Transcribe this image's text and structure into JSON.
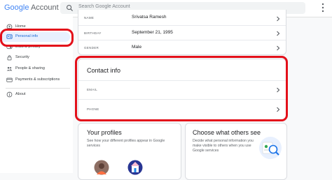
{
  "header": {
    "logo_google": "Google",
    "logo_account": "Account",
    "search_placeholder": "Search Google Account"
  },
  "sidebar": {
    "items": [
      {
        "label": "Home"
      },
      {
        "label": "Personal info"
      },
      {
        "label": "Data & privacy"
      },
      {
        "label": "Security"
      },
      {
        "label": "People & sharing"
      },
      {
        "label": "Payments & subscriptions"
      },
      {
        "label": "About"
      }
    ]
  },
  "basic_info": {
    "rows": [
      {
        "label": "NAME",
        "value": "Srivatsa Ramesh"
      },
      {
        "label": "BIRTHDAY",
        "value": "September 21, 1995"
      },
      {
        "label": "GENDER",
        "value": "Male"
      }
    ]
  },
  "contact_info": {
    "title": "Contact info",
    "rows": [
      {
        "label": "EMAIL",
        "value": ""
      },
      {
        "label": "PHONE",
        "value": ""
      }
    ]
  },
  "profiles_card": {
    "title": "Your profiles",
    "description": "See how your different profiles appear in Google services"
  },
  "choose_card": {
    "title": "Choose what others see",
    "description": "Decide what personal information you make visible to others when you use Google services"
  },
  "colors": {
    "highlight_red": "#e3101a",
    "active_blue": "#1967d2",
    "active_bg": "#e8f0fe"
  }
}
